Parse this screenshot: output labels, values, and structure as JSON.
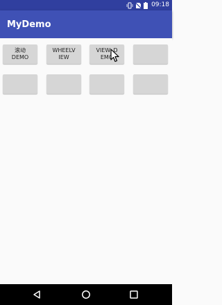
{
  "status_bar": {
    "time": "09:18",
    "icons": [
      "vibrate-icon",
      "no-sim-icon",
      "battery-icon"
    ]
  },
  "app_bar": {
    "title": "MyDemo",
    "background": "#3f51b5",
    "status_background": "#303f9f"
  },
  "buttons": [
    {
      "label": "滚动\nDEMO"
    },
    {
      "label": "WHEELV\nIEW"
    },
    {
      "label": "VIEW_D\nEMO"
    },
    {
      "label": ""
    },
    {
      "label": ""
    },
    {
      "label": ""
    },
    {
      "label": ""
    },
    {
      "label": ""
    }
  ],
  "navigation_bar": {
    "icons": [
      "back-icon",
      "home-icon",
      "recents-icon"
    ]
  }
}
